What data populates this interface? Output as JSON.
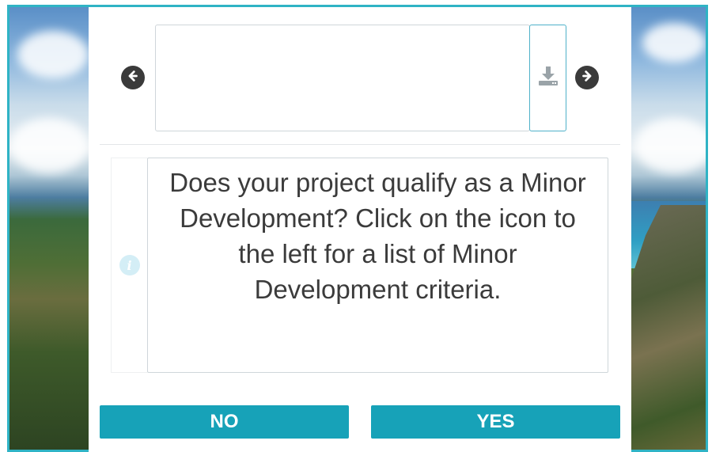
{
  "preview": {
    "prev_icon": "arrow-left-circle-icon",
    "next_icon": "arrow-right-circle-icon",
    "download_icon": "download-icon"
  },
  "question": {
    "info_icon": "info-circle-icon",
    "text": "Does your project qualify as a Minor Development? Click on the icon to the left for a list of Minor Development criteria."
  },
  "answers": {
    "no_label": "NO",
    "yes_label": "YES"
  },
  "colors": {
    "frame_border": "#2fb3c5",
    "button_bg": "#17a2b8",
    "arrow_bg": "#3a3a3a",
    "info_bg": "#d4eef6"
  }
}
